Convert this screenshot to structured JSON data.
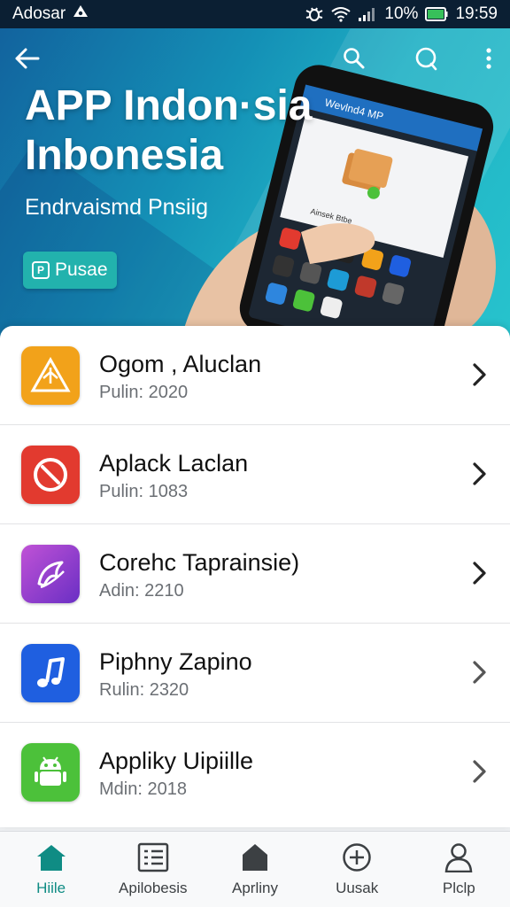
{
  "status_bar": {
    "carrier": "Adosar",
    "battery": "10%",
    "time": "19:59"
  },
  "hero": {
    "title_line1": "APP Indon·sia",
    "title_line2": "Inbonesia",
    "subtitle": "Endrvaismd Pnsiig",
    "button_label": "Pusae",
    "phone_screen_title": "Wevlnd4 MP",
    "phone_card_text": "Ainsek Btbe"
  },
  "apps": [
    {
      "name": "Ogom , Aluclan",
      "meta": "Pulin: 2020",
      "icon": "warning-triangle-icon",
      "color": "#f2a21a"
    },
    {
      "name": "Aplack Laclan",
      "meta": "Pulin: 1083",
      "icon": "block-circle-icon",
      "color": "#e23a2f"
    },
    {
      "name": "Corehc Taprainsie)",
      "meta": "Adin: 2210",
      "icon": "swirl-icon",
      "color": "#8b3fd0"
    },
    {
      "name": "Piphny Zapino",
      "meta": "Rulin: 2320",
      "icon": "music-note-icon",
      "color": "#1f5fe0"
    },
    {
      "name": "Appliky Uipiille",
      "meta": "Mdin: 2018",
      "icon": "android-robot-icon",
      "color": "#4cc13a"
    }
  ],
  "nav": [
    {
      "label": "Hiile",
      "icon": "home-icon",
      "active": true
    },
    {
      "label": "Apilobesis",
      "icon": "list-icon",
      "active": false
    },
    {
      "label": "Aprliny",
      "icon": "house-icon",
      "active": false
    },
    {
      "label": "Uusak",
      "icon": "add-circle-icon",
      "active": false
    },
    {
      "label": "Plclp",
      "icon": "person-icon",
      "active": false
    }
  ],
  "colors": {
    "accent": "#0f8c84",
    "hero_start": "#12639e",
    "hero_end": "#27c3cd",
    "button": "#22b2ad"
  }
}
